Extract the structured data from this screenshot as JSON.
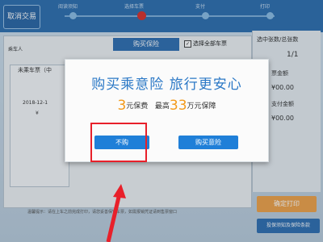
{
  "topbar": {
    "cancel_label": "取消交易",
    "steps": [
      "阅读须知",
      "选择车票",
      "支付",
      "打印"
    ]
  },
  "background": {
    "passenger_label": "乘车人",
    "unpaid_label": "未乘车票（中",
    "date_text": "2018-12-1",
    "price_symbol": "¥",
    "buy_insurance_tab": "购买保险",
    "select_all_label": "选择全部车票",
    "right_header": "选中张数/总张数",
    "count_value": "1/1",
    "ticket_amount_label": "票金额",
    "ticket_amount_value": "¥00.00",
    "pay_amount_label": "支付金额",
    "pay_amount_value": "¥00.00",
    "confirm_print": "确定打印",
    "insurance_notice": "投保须知及保险条款",
    "bottom_note": "温馨提示：请在上车之前完成打印，请您妥善保管车票，如需报销凭证请到售票窗口"
  },
  "modal": {
    "title": "购买乘意险 旅行更安心",
    "premium_num": "3",
    "premium_text": "元保费",
    "max_text": "最高",
    "coverage_num": "33",
    "coverage_text": "万元保障",
    "no_buy_label": "不购",
    "buy_label": "购买意险"
  },
  "colors": {
    "accent_blue": "#2b78c6",
    "button_blue": "#1f7fd8",
    "highlight_orange": "#f39a1b",
    "annotation_red": "#e8202a"
  }
}
